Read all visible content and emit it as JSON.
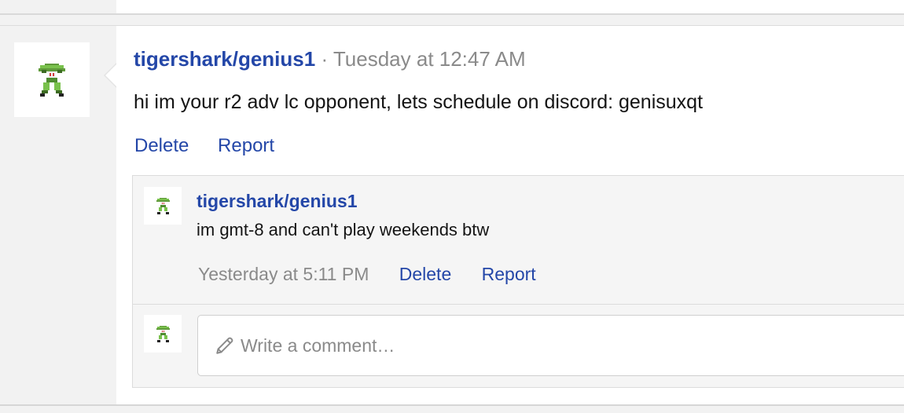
{
  "post": {
    "author": "tigershark/genius1",
    "separator": "·",
    "timestamp": "Tuesday at 12:47 AM",
    "body": "hi im your r2 adv lc opponent, lets schedule on discord: genisuxqt",
    "actions": {
      "delete": "Delete",
      "report": "Report"
    },
    "avatar_icon": "pokemon-sprite-avatar"
  },
  "comments": [
    {
      "author": "tigershark/genius1",
      "text": "im gmt-8 and can't play weekends btw",
      "timestamp": "Yesterday at 5:11 PM",
      "actions": {
        "delete": "Delete",
        "report": "Report"
      },
      "avatar_icon": "pokemon-sprite-avatar"
    }
  ],
  "comment_input": {
    "placeholder": "Write a comment…",
    "icon": "pencil-icon"
  },
  "colors": {
    "link": "#2447a8",
    "muted": "#8a8a8a",
    "text": "#141414",
    "page_bg": "#f2f2f2",
    "comment_bg": "#f5f5f5"
  }
}
